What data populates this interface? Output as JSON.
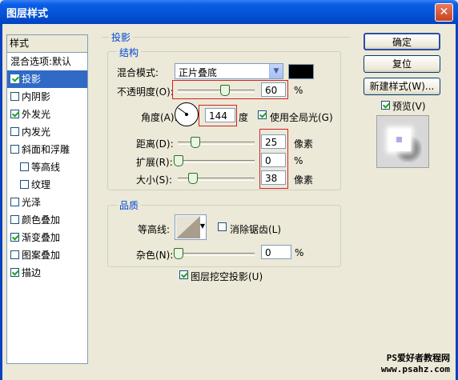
{
  "window": {
    "title": "图层样式",
    "close_glyph": "✕"
  },
  "style_list": {
    "header": "样式",
    "items": [
      {
        "label": "混合选项:默认",
        "checkbox": false,
        "checked": false,
        "selected": false,
        "indent": false
      },
      {
        "label": "投影",
        "checkbox": true,
        "checked": true,
        "selected": true,
        "indent": false
      },
      {
        "label": "内阴影",
        "checkbox": true,
        "checked": false,
        "selected": false,
        "indent": false
      },
      {
        "label": "外发光",
        "checkbox": true,
        "checked": true,
        "selected": false,
        "indent": false
      },
      {
        "label": "内发光",
        "checkbox": true,
        "checked": false,
        "selected": false,
        "indent": false
      },
      {
        "label": "斜面和浮雕",
        "checkbox": true,
        "checked": false,
        "selected": false,
        "indent": false
      },
      {
        "label": "等高线",
        "checkbox": true,
        "checked": false,
        "selected": false,
        "indent": true
      },
      {
        "label": "纹理",
        "checkbox": true,
        "checked": false,
        "selected": false,
        "indent": true
      },
      {
        "label": "光泽",
        "checkbox": true,
        "checked": false,
        "selected": false,
        "indent": false
      },
      {
        "label": "颜色叠加",
        "checkbox": true,
        "checked": false,
        "selected": false,
        "indent": false
      },
      {
        "label": "渐变叠加",
        "checkbox": true,
        "checked": true,
        "selected": false,
        "indent": false
      },
      {
        "label": "图案叠加",
        "checkbox": true,
        "checked": false,
        "selected": false,
        "indent": false
      },
      {
        "label": "描边",
        "checkbox": true,
        "checked": true,
        "selected": false,
        "indent": false
      }
    ]
  },
  "panel": {
    "section_title": "投影",
    "structure": {
      "title": "结构",
      "blend_mode_label": "混合模式:",
      "blend_mode_value": "正片叠底",
      "shadow_color": "#000000",
      "opacity_label": "不透明度(O):",
      "opacity_value": "60",
      "opacity_unit": "%",
      "opacity_level": 60,
      "angle_label": "角度(A):",
      "angle_value": "144",
      "angle_unit": "度",
      "global_light_label": "使用全局光(G)",
      "global_light_checked": true,
      "distance_label": "距离(D):",
      "distance_value": "25",
      "distance_unit": "像素",
      "spread_label": "扩展(R):",
      "spread_value": "0",
      "spread_unit": "%",
      "size_label": "大小(S):",
      "size_value": "38",
      "size_unit": "像素"
    },
    "quality": {
      "title": "品质",
      "contour_label": "等高线:",
      "anti_alias_label": "消除锯齿(L)",
      "anti_alias_checked": false,
      "noise_label": "杂色(N):",
      "noise_value": "0",
      "noise_unit": "%"
    },
    "knockout_label": "图层挖空投影(U)",
    "knockout_checked": true
  },
  "buttons": {
    "ok": "确定",
    "reset": "复位",
    "new_style": "新建样式(W)...",
    "preview_label": "预览(V)",
    "preview_checked": true
  },
  "watermark": {
    "line1": "PS爱好者教程网",
    "line2": "www.psahz.com"
  }
}
